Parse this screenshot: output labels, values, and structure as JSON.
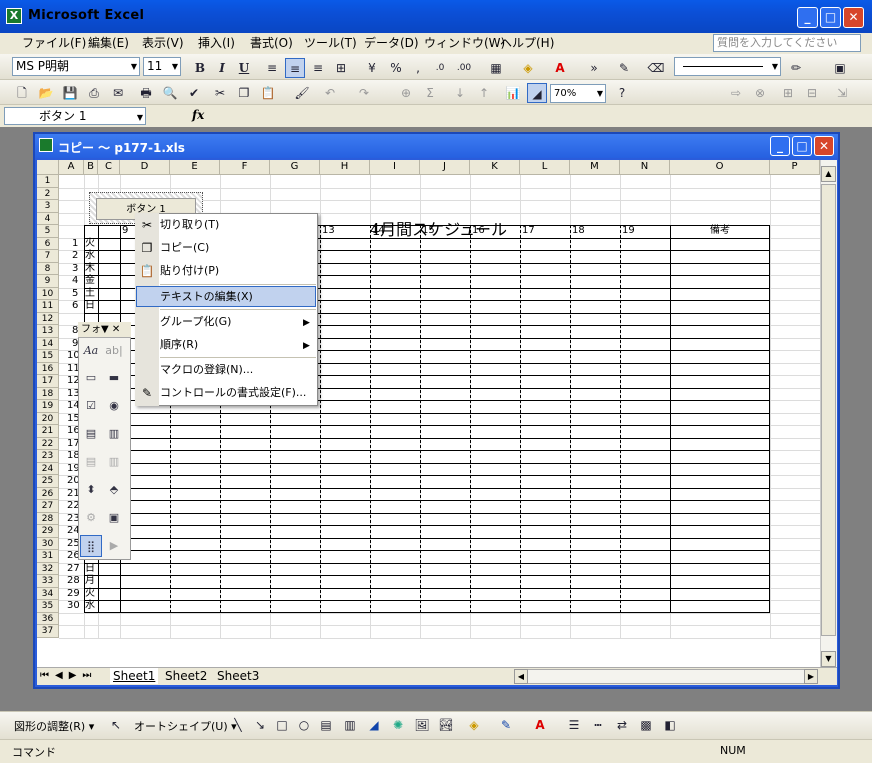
{
  "app": {
    "title": "Microsoft Excel",
    "icon_letter": "X"
  },
  "window_buttons": {
    "minimize": "_",
    "maximize": "□",
    "close": "✕"
  },
  "menu": {
    "items": [
      "ファイル(F)",
      "編集(E)",
      "表示(V)",
      "挿入(I)",
      "書式(O)",
      "ツール(T)",
      "データ(D)",
      "ウィンドウ(W)",
      "ヘルプ(H)"
    ],
    "help_placeholder": "質問を入力してください"
  },
  "toolbar": {
    "font_name": "MS P明朝",
    "font_size": "11",
    "zoom": "70%",
    "bold": "B",
    "italic": "I",
    "underline": "U",
    "percent": "%",
    "comma": ",",
    "sigma": "Σ"
  },
  "formula": {
    "name_box": "ボタン 1",
    "fx": "fx"
  },
  "document": {
    "title": "コピー ～ p177-1.xls"
  },
  "sheet": {
    "columns": [
      "A",
      "B",
      "C",
      "D",
      "E",
      "F",
      "G",
      "H",
      "I",
      "J",
      "K",
      "L",
      "M",
      "N",
      "O",
      "P"
    ],
    "rows": [
      "1",
      "2",
      "3",
      "4",
      "5",
      "6",
      "7",
      "8",
      "9",
      "10",
      "11",
      "12",
      "13",
      "14",
      "15",
      "16",
      "17",
      "18",
      "19",
      "20",
      "21",
      "22",
      "23",
      "24",
      "25",
      "26",
      "27",
      "28",
      "29",
      "30",
      "31",
      "32",
      "33",
      "34",
      "35",
      "36",
      "37"
    ],
    "schedule_title": "4月間スケジュール",
    "hour_labels": [
      "9",
      "13",
      "14",
      "15",
      "16",
      "17",
      "18",
      "19"
    ],
    "notes_header": "備考",
    "button_label": "ボタン 1",
    "days_top": [
      {
        "n": "1",
        "d": "火"
      },
      {
        "n": "2",
        "d": "水"
      },
      {
        "n": "3",
        "d": "木"
      },
      {
        "n": "4",
        "d": "金"
      },
      {
        "n": "5",
        "d": "土"
      },
      {
        "n": "6",
        "d": "日"
      }
    ],
    "days_hidden_nums": [
      "8",
      "9",
      "10",
      "11",
      "12",
      "13",
      "14",
      "15",
      "16",
      "17",
      "18",
      "19",
      "20",
      "21",
      "22",
      "23",
      "24"
    ],
    "days_bottom": [
      {
        "n": "25",
        "d": "金"
      },
      {
        "n": "26",
        "d": "土"
      },
      {
        "n": "27",
        "d": "日"
      },
      {
        "n": "28",
        "d": "月"
      },
      {
        "n": "29",
        "d": "火"
      },
      {
        "n": "30",
        "d": "水"
      }
    ],
    "tabs": [
      "Sheet1",
      "Sheet2",
      "Sheet3"
    ]
  },
  "context_menu": {
    "items": [
      {
        "label": "切り取り(T)",
        "icon": "scissors-icon",
        "glyph": "✂"
      },
      {
        "label": "コピー(C)",
        "icon": "copy-icon",
        "glyph": "❐"
      },
      {
        "label": "貼り付け(P)",
        "icon": "paste-icon",
        "glyph": "📋"
      },
      {
        "label": "テキストの編集(X)",
        "icon": "",
        "glyph": ""
      },
      {
        "label": "グループ化(G)",
        "icon": "",
        "glyph": ""
      },
      {
        "label": "順序(R)",
        "icon": "",
        "glyph": ""
      },
      {
        "label": "マクロの登録(N)...",
        "icon": "",
        "glyph": ""
      },
      {
        "label": "コントロールの書式設定(F)...",
        "icon": "format-control-icon",
        "glyph": "✎"
      }
    ],
    "highlight_color": "#c1d2ee"
  },
  "forms_toolbar": {
    "title": "フォ▼ ✕",
    "label_glyph": "Aa",
    "edit_glyph": "ab|"
  },
  "drawing_toolbar": {
    "draw": "図形の調整(R) ▾",
    "autoshape": "オートシェイプ(U) ▾"
  },
  "status": {
    "mode": "コマンド",
    "num": "NUM"
  }
}
